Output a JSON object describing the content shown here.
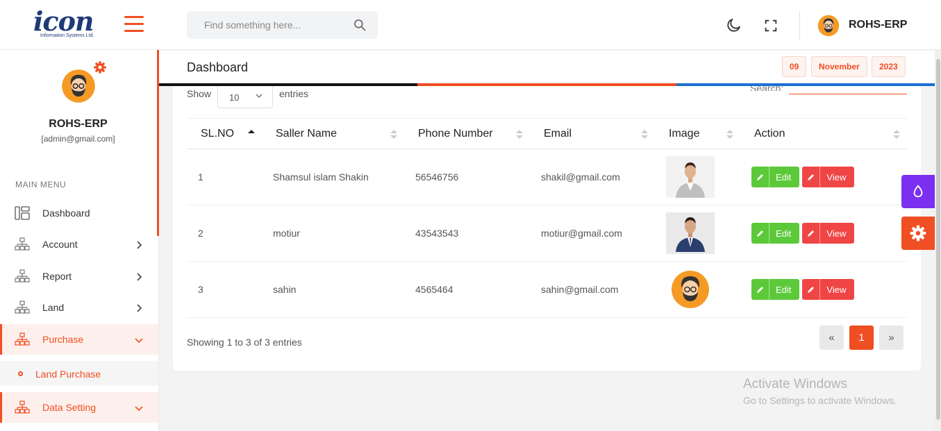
{
  "brand": {
    "logo_text": "icon",
    "logo_sub": "Information Systems Ltd."
  },
  "header": {
    "search_placeholder": "Find something here...",
    "user_name": "ROHS-ERP"
  },
  "sidebar": {
    "user_name": "ROHS-ERP",
    "user_email": "[admin@gmail.com]",
    "menu_title": "MAIN MENU",
    "items": [
      {
        "label": "Dashboard",
        "icon": "dashboard-icon"
      },
      {
        "label": "Account",
        "icon": "sitemap-icon"
      },
      {
        "label": "Report",
        "icon": "sitemap-icon"
      },
      {
        "label": "Land",
        "icon": "sitemap-icon"
      },
      {
        "label": "Purchase",
        "icon": "sitemap-icon"
      },
      {
        "label": "Data Setting",
        "icon": "sitemap-icon"
      }
    ],
    "sub_item": "Land Purchase"
  },
  "page": {
    "title": "Dashboard",
    "date": {
      "day": "09",
      "month": "November",
      "year": "2023"
    }
  },
  "table_controls": {
    "show_label": "Show",
    "entries_value": "10",
    "entries_label": "entries",
    "search_label": "Search:"
  },
  "table": {
    "columns": [
      "SL.NO",
      "Saller Name",
      "Phone Number",
      "Email",
      "Image",
      "Action"
    ],
    "rows": [
      {
        "sl": "1",
        "name": "Shamsul islam Shakin",
        "phone": "56546756",
        "email": "shakil@gmail.com"
      },
      {
        "sl": "2",
        "name": "motiur",
        "phone": "43543543",
        "email": "motiur@gmail.com"
      },
      {
        "sl": "3",
        "name": "sahin",
        "phone": "4565464",
        "email": "sahin@gmail.com"
      }
    ],
    "edit_label": "Edit",
    "view_label": "View",
    "showing_text": "Showing 1 to 3 of 3 entries",
    "current_page": "1",
    "prev_label": "«",
    "next_label": "»"
  },
  "watermark": {
    "line1": "Activate Windows",
    "line2": "Go to Settings to activate Windows."
  },
  "colors": {
    "accent": "#f04e23",
    "edit": "#5cc93a",
    "view": "#f04545",
    "purple": "#7b2ff0",
    "bar_black": "#111111",
    "bar_orange": "#f04e23",
    "bar_blue": "#1e6fd0"
  }
}
